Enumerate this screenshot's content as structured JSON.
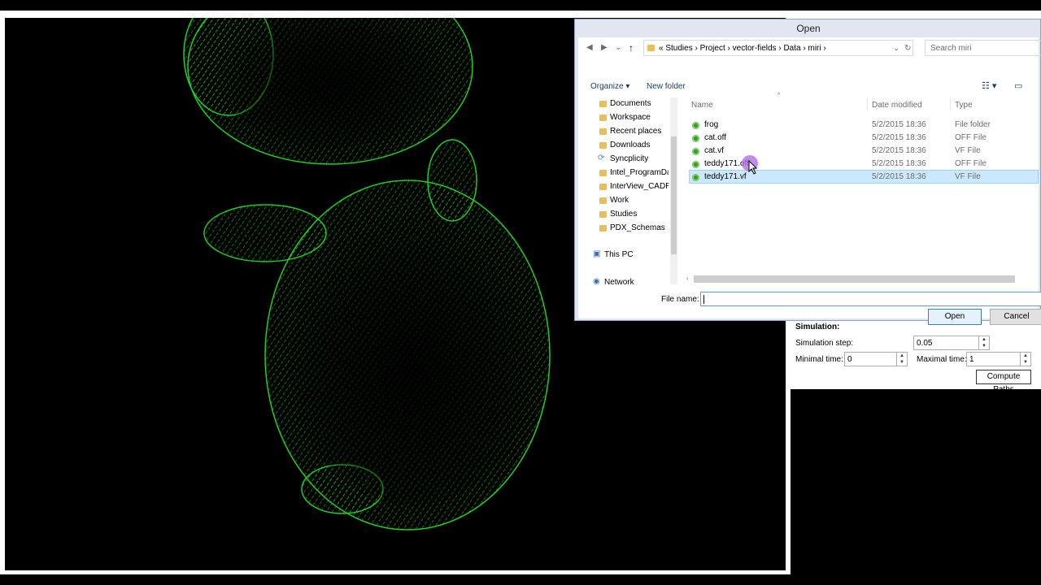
{
  "dialog": {
    "title": "Open",
    "breadcrumb": [
      "«",
      "Studies",
      "›",
      "Project",
      "›",
      "vector-fields",
      "›",
      "Data",
      "›",
      "miri",
      "›"
    ],
    "search_placeholder": "Search miri",
    "toolbar": {
      "organize": "Organize ▾",
      "new_folder": "New folder"
    },
    "nav_items": [
      {
        "label": "Documents",
        "icon": "folder-icon"
      },
      {
        "label": "Workspace",
        "icon": "folder-icon"
      },
      {
        "label": "Recent places",
        "icon": "folder-icon"
      },
      {
        "label": "Downloads",
        "icon": "folder-icon"
      },
      {
        "label": "Syncplicity",
        "icon": "sync-icon"
      },
      {
        "label": "Intel_ProgramDat",
        "icon": "folder-icon"
      },
      {
        "label": "InterView_CADRC",
        "icon": "folder-icon"
      },
      {
        "label": "Work",
        "icon": "folder-icon"
      },
      {
        "label": "Studies",
        "icon": "folder-icon"
      },
      {
        "label": "PDX_Schemas",
        "icon": "folder-icon"
      }
    ],
    "this_pc": "This PC",
    "network": "Network",
    "columns": {
      "name": "Name",
      "date": "Date modified",
      "type": "Type"
    },
    "files": [
      {
        "name": "frog",
        "date": "5/2/2015 18:36",
        "type": "File folder"
      },
      {
        "name": "cat.off",
        "date": "5/2/2015 18:36",
        "type": "OFF File"
      },
      {
        "name": "cat.vf",
        "date": "5/2/2015 18:36",
        "type": "VF File"
      },
      {
        "name": "teddy171.off",
        "date": "5/2/2015 18:36",
        "type": "OFF File"
      },
      {
        "name": "teddy171.vf",
        "date": "5/2/2015 18:36",
        "type": "VF File"
      }
    ],
    "selected_file": "teddy171.vf",
    "file_name_label": "File name:",
    "file_name_value": "",
    "open_label": "Open",
    "cancel_label": "Cancel"
  },
  "simulation": {
    "heading": "Simulation:",
    "step_label": "Simulation step:",
    "step_value": "0.05",
    "min_label": "Minimal time:",
    "min_value": "0",
    "max_label": "Maximal time:",
    "max_value": "1",
    "compute_label": "Compute Paths"
  },
  "colors": {
    "mesh": "#1fcf1f",
    "selection": "#cce8ff",
    "accent": "#3c7fb1"
  }
}
